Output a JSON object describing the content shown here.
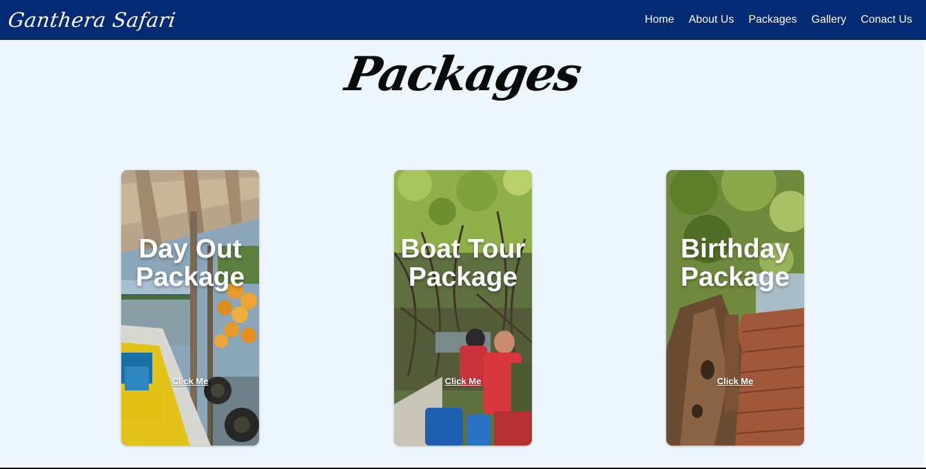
{
  "nav": {
    "brand": "Ganthera Safari",
    "links": [
      "Home",
      "About Us",
      "Packages",
      "Gallery",
      "Conact Us"
    ]
  },
  "page": {
    "title": "Packages"
  },
  "cards": [
    {
      "title_line1": "Day Out",
      "title_line2": "Package",
      "link": "Click Me"
    },
    {
      "title_line1": "Boat Tour",
      "title_line2": "Package",
      "link": "Click Me"
    },
    {
      "title_line1": "Birthday",
      "title_line2": "Package",
      "link": "Click Me"
    }
  ],
  "colors": {
    "navbar": "#032a73",
    "background": "#eef6fd",
    "text_light": "#ffffff"
  },
  "icons": []
}
